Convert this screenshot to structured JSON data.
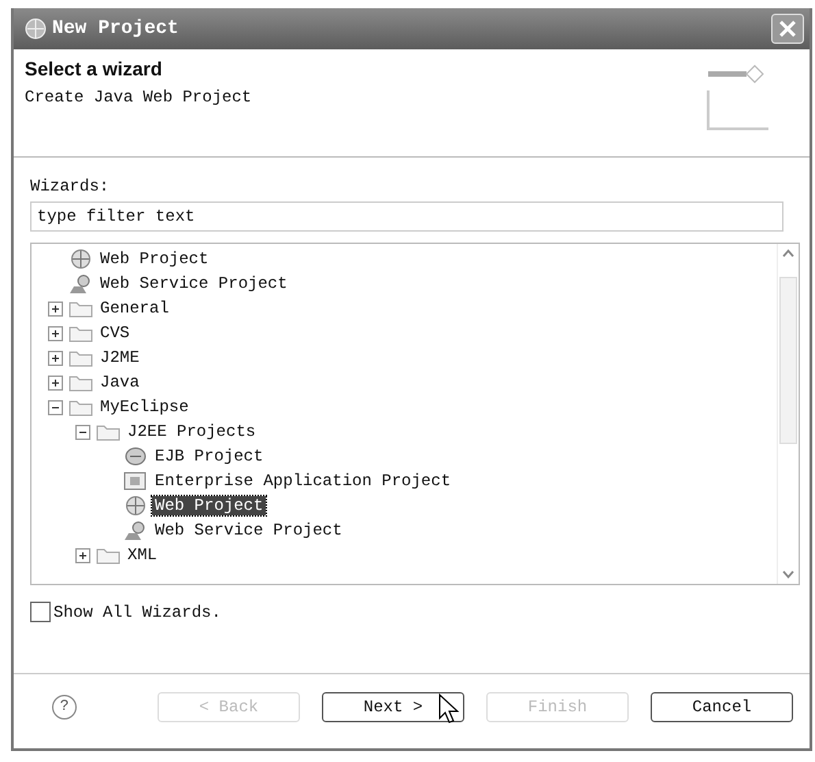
{
  "window": {
    "title": "New Project"
  },
  "header": {
    "title": "Select a wizard",
    "description": "Create Java Web Project"
  },
  "wizards_label": "Wizards:",
  "filter": {
    "value": "type filter text"
  },
  "tree": {
    "items": [
      {
        "label": "Web Project",
        "kind": "web",
        "selected": false
      },
      {
        "label": "Web Service Project",
        "kind": "service",
        "selected": false
      },
      {
        "label": "General",
        "kind": "folder",
        "expanded": false,
        "selected": false
      },
      {
        "label": "CVS",
        "kind": "folder",
        "expanded": false,
        "selected": false
      },
      {
        "label": "J2ME",
        "kind": "folder",
        "expanded": false,
        "selected": false
      },
      {
        "label": "Java",
        "kind": "folder",
        "expanded": false,
        "selected": false
      },
      {
        "label": "MyEclipse",
        "kind": "folder",
        "expanded": true,
        "selected": false,
        "children": [
          {
            "label": "J2EE Projects",
            "kind": "folder",
            "expanded": true,
            "selected": false,
            "children": [
              {
                "label": "EJB Project",
                "kind": "ejb",
                "selected": false
              },
              {
                "label": "Enterprise Application Project",
                "kind": "ear",
                "selected": false
              },
              {
                "label": "Web Project",
                "kind": "web",
                "selected": true
              },
              {
                "label": "Web Service Project",
                "kind": "service",
                "selected": false
              }
            ]
          },
          {
            "label": "XML",
            "kind": "folder",
            "expanded": false,
            "selected": false
          }
        ]
      }
    ]
  },
  "show_all": {
    "label": "Show All Wizards.",
    "checked": false
  },
  "help_button": "?",
  "buttons": [
    {
      "label": "< Back",
      "disabled": true
    },
    {
      "label": "Next >",
      "disabled": false
    },
    {
      "label": "Finish",
      "disabled": true
    },
    {
      "label": "Cancel",
      "disabled": false
    }
  ]
}
